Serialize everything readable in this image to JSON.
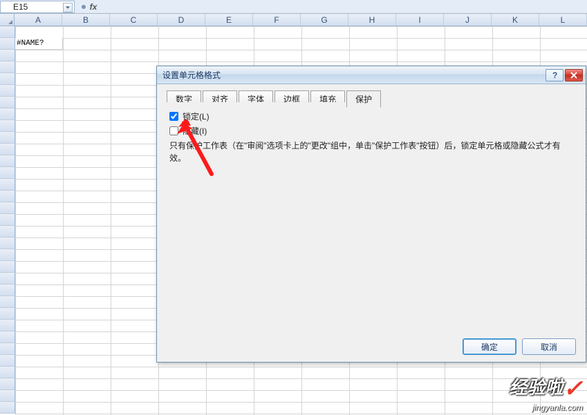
{
  "namebox": {
    "value": "E15"
  },
  "fx": {
    "label": "fx"
  },
  "columns": [
    "A",
    "B",
    "C",
    "D",
    "E",
    "F",
    "G",
    "H",
    "I",
    "J",
    "K",
    "L"
  ],
  "cellA1": "#NAME?",
  "dialog": {
    "title": "设置单元格格式",
    "tabs": {
      "number": "数字",
      "align": "对齐",
      "font": "字体",
      "border": "边框",
      "fill": "填充",
      "protect": "保护"
    },
    "lock_label": "锁定(L)",
    "hide_label": "隐藏(I)",
    "note": "只有保护工作表（在\"审阅\"选项卡上的\"更改\"组中，单击\"保护工作表\"按钮）后，锁定单元格或隐藏公式才有效。",
    "ok": "确定",
    "cancel": "取消"
  },
  "watermark": {
    "big": "经验啦",
    "sub": "jingyanla.com"
  }
}
